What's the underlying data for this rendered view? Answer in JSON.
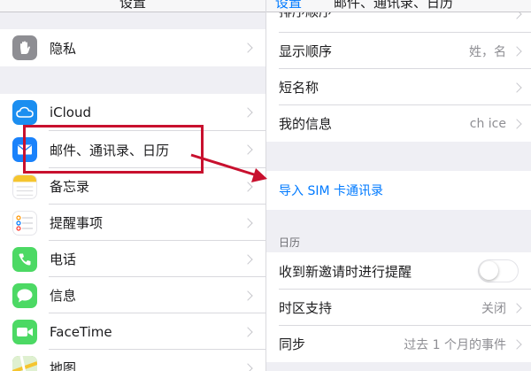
{
  "colors": {
    "accent": "#007aff",
    "annotation": "#c8102e",
    "grouped_background": "#efeff4"
  },
  "left_panel": {
    "title": "设置",
    "items": [
      {
        "label": "隐私",
        "icon": "hand-icon",
        "icon_color": "#8e8e93"
      },
      {
        "label": "iCloud",
        "icon": "cloud-icon",
        "icon_color": "#1b8ef0"
      },
      {
        "label": "邮件、通讯录、日历",
        "icon": "mail-icon",
        "icon_color": "#1a82fb"
      },
      {
        "label": "备忘录",
        "icon": "notes-icon",
        "icon_color": "#f5c52f"
      },
      {
        "label": "提醒事项",
        "icon": "reminders-icon",
        "icon_color": "#ffffff"
      },
      {
        "label": "电话",
        "icon": "phone-icon",
        "icon_color": "#4cd964"
      },
      {
        "label": "信息",
        "icon": "messages-icon",
        "icon_color": "#4cd964"
      },
      {
        "label": "FaceTime",
        "icon": "facetime-icon",
        "icon_color": "#4cd964"
      },
      {
        "label": "地图",
        "icon": "maps-icon",
        "icon_color": "#6cc04a"
      }
    ]
  },
  "right_panel": {
    "back_label": "设置",
    "title": "邮件、通讯录、日历",
    "top_partial_label": "排序顺序",
    "contacts_rows": [
      {
        "label": "显示顺序",
        "value": "姓，名"
      },
      {
        "label": "短名称",
        "value": ""
      },
      {
        "label": "我的信息",
        "value": "ch ice"
      }
    ],
    "import_sim_label": "导入 SIM 卡通讯录",
    "calendar_header": "日历",
    "calendar_rows": [
      {
        "label": "收到新邀请时进行提醒",
        "toggle_on": false
      },
      {
        "label": "时区支持",
        "value": "关闭"
      },
      {
        "label": "同步",
        "value": "过去 1 个月的事件"
      }
    ]
  }
}
